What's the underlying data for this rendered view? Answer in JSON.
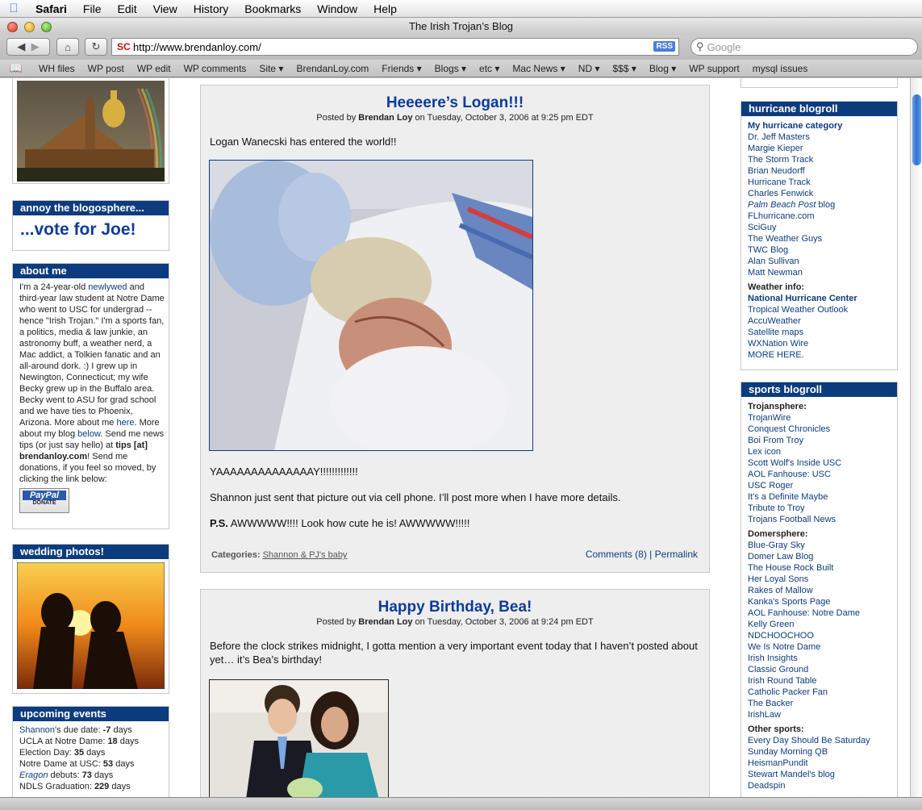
{
  "menubar": {
    "app": "Safari",
    "items": [
      "File",
      "Edit",
      "View",
      "History",
      "Bookmarks",
      "Window",
      "Help"
    ]
  },
  "window": {
    "title": "The Irish Trojan’s Blog"
  },
  "toolbar": {
    "url": "http://www.brendanloy.com/",
    "rss": "RSS",
    "search_placeholder": "Google"
  },
  "bookmarks": [
    "WH files",
    "WP post",
    "WP edit",
    "WP comments",
    "Site ▾",
    "BrendanLoy.com",
    "Friends ▾",
    "Blogs ▾",
    "etc ▾",
    "Mac News ▾",
    "ND ▾",
    "$$$ ▾",
    "Blog ▾",
    "WP support",
    "mysql issues"
  ],
  "left": {
    "annoy_title": "annoy the blogosphere...",
    "annoy_link": "...vote for Joe!",
    "about_title": "about me",
    "about": {
      "t1": "I'm a 24-year-old ",
      "l1": "newlywed",
      "t2": " and third-year law student at Notre Dame who went to USC for undergrad -- hence \"Irish Trojan.\" I'm a sports fan, a politics, media & law junkie, an astronomy buff, a weather nerd, a Mac addict, a Tolkien fanatic and an all-around dork. :) I grew up in Newington, Connecticut; my wife Becky grew up in the Buffalo area. Becky went to ASU for grad school and we have ties to Phoenix, Arizona. More about me ",
      "l2": "here",
      "t3": ". More about my blog ",
      "l3": "below",
      "t4": ". Send me news tips (or just say hello) at ",
      "b1": "tips [at] brendanloy.com",
      "t5": "! Send me donations, if you feel so moved, by clicking the link below:"
    },
    "paypal_top": "PayPal",
    "paypal_bottom": "DONATE",
    "wedding_title": "wedding photos!",
    "events_title": "upcoming events",
    "events": [
      {
        "label": "Shannon",
        "rest": "'s due date: ",
        "value": "-7",
        "unit": " days",
        "link": true,
        "italic": false
      },
      {
        "label": "",
        "rest": "UCLA at Notre Dame: ",
        "value": "18",
        "unit": " days",
        "link": false,
        "italic": false
      },
      {
        "label": "",
        "rest": "Election Day: ",
        "value": "35",
        "unit": " days",
        "link": false,
        "italic": false
      },
      {
        "label": "",
        "rest": "Notre Dame at USC: ",
        "value": "53",
        "unit": " days",
        "link": false,
        "italic": false
      },
      {
        "label": "Eragon",
        "rest": " debuts: ",
        "value": "73",
        "unit": " days",
        "link": true,
        "italic": true
      },
      {
        "label": "",
        "rest": "NDLS Graduation: ",
        "value": "229",
        "unit": " days",
        "link": false,
        "italic": false
      }
    ]
  },
  "posts": [
    {
      "title": "Heeeere’s Logan!!!",
      "posted_by": "Posted by ",
      "author": "Brendan Loy",
      "date": " on Tuesday, October 3, 2006 at 9:25 pm EDT",
      "p1": "Logan Wanecski has entered the world!!",
      "p2": "YAAAAAAAAAAAAAAY!!!!!!!!!!!!!",
      "p3": "Shannon just sent that picture out via cell phone. I’ll post more when I have more details.",
      "ps_label": "P.S.",
      "ps_text": " AWWWWW!!!! Look how cute he is! AWWWWW!!!!!",
      "categories_label": "Categories:",
      "category": "Shannon & PJ's baby",
      "comments": "Comments (8)",
      "sep": "|",
      "permalink": "Permalink"
    },
    {
      "title": "Happy Birthday, Bea!",
      "posted_by": "Posted by ",
      "author": "Brendan Loy",
      "date": " on Tuesday, October 3, 2006 at 9:24 pm EDT",
      "p1": "Before the clock strikes midnight, I gotta mention a very important event today that I haven’t posted about yet… it’s Bea’s birthday!"
    }
  ],
  "right": {
    "hurricane_title": "hurricane blogroll",
    "hurricane_links": [
      {
        "t": "My hurricane category",
        "b": true,
        "i": false
      },
      {
        "t": "Dr. Jeff Masters",
        "b": false,
        "i": false
      },
      {
        "t": "Margie Kieper",
        "b": false,
        "i": false
      },
      {
        "t": "The Storm Track",
        "b": false,
        "i": false
      },
      {
        "t": "Brian Neudorff",
        "b": false,
        "i": false
      },
      {
        "t": "Hurricane Track",
        "b": false,
        "i": false
      },
      {
        "t": "Charles Fenwick",
        "b": false,
        "i": false
      },
      {
        "t": "FLhurricane.com",
        "b": false,
        "i": false
      },
      {
        "t": "SciGuy",
        "b": false,
        "i": false
      },
      {
        "t": "The Weather Guys",
        "b": false,
        "i": false
      },
      {
        "t": "TWC Blog",
        "b": false,
        "i": false
      },
      {
        "t": "Alan Sullivan",
        "b": false,
        "i": false
      },
      {
        "t": "Matt Newman",
        "b": false,
        "i": false
      }
    ],
    "pbp_italic": "Palm Beach Post",
    "pbp_rest": " blog",
    "weather_info": "Weather info:",
    "weather_links": [
      {
        "t": "National Hurricane Center",
        "b": true
      },
      {
        "t": "Tropical Weather Outlook",
        "b": false
      },
      {
        "t": "AccuWeather",
        "b": false
      },
      {
        "t": "Satellite maps",
        "b": false
      },
      {
        "t": "WXNation Wire",
        "b": false
      },
      {
        "t": "MORE HERE.",
        "b": false
      }
    ],
    "sports_title": "sports blogroll",
    "trojansphere": "Trojansphere:",
    "trojan_links": [
      "TrojanWire",
      "Conquest Chronicles",
      "Boi From Troy",
      "Lex icon",
      "Scott Wolf's Inside USC",
      "AOL Fanhouse: USC",
      "USC Roger",
      "It's a Definite Maybe",
      "Tribute to Troy",
      "Trojans Football News"
    ],
    "domersphere": "Domersphere:",
    "domer_links": [
      "Blue-Gray Sky",
      "Domer Law Blog",
      "The House Rock Built",
      "Her Loyal Sons",
      "Rakes of Mallow",
      "Kanka's Sports Page",
      "AOL Fanhouse: Notre Dame",
      "Kelly Green",
      "NDCHOOCHOO",
      "We Is Notre Dame",
      "Irish Insights",
      "Classic Ground",
      "Irish Round Table",
      "Catholic Packer Fan",
      "The Backer",
      "IrishLaw"
    ],
    "other_sports": "Other sports:",
    "other_links": [
      "Every Day Should Be Saturday",
      "Sunday Morning QB",
      "HeismanPundit",
      "Stewart Mandel's blog",
      "Deadspin"
    ]
  },
  "colors": {
    "header_blue": "#0d3c7e",
    "title_blue": "#0d3c9a",
    "post_bg": "#eeeeee"
  }
}
